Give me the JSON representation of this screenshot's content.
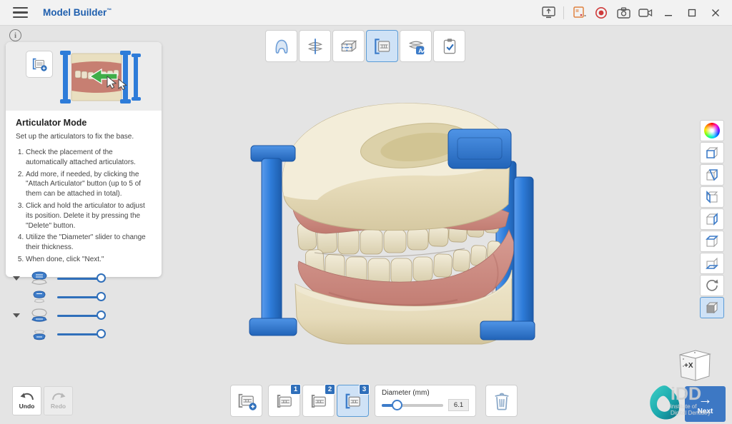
{
  "titlebar": {
    "title": "Model Builder",
    "title_mark": "™",
    "tool_icons": [
      "screen-share",
      "capture-panel",
      "record",
      "screenshot-camera",
      "video-capture"
    ],
    "window_controls": [
      "minimize",
      "maximize",
      "close"
    ]
  },
  "workflow_toolbar": {
    "steps": [
      {
        "icon": "impression-step",
        "selected": false
      },
      {
        "icon": "occlusion-step",
        "selected": false
      },
      {
        "icon": "base-step",
        "selected": false
      },
      {
        "icon": "articulator-step",
        "selected": true
      },
      {
        "icon": "label-step",
        "selected": false
      },
      {
        "icon": "finish-step",
        "selected": false
      }
    ]
  },
  "instruction_card": {
    "info_icon": "i",
    "thumb_icon": "attach-articulator",
    "title": "Articulator Mode",
    "intro": "Set up the articulators to fix the base.",
    "steps": [
      "Check the placement of the automatically attached articulators.",
      "Add more, if needed, by clicking the \"Attach Articulator\" button (up to 5 of them can be attached in total).",
      "Click and hold the articulator to adjust its position. Delete it by pressing the \"Delete\" button.",
      "Utilize the \"Diameter\" slider to change their thickness.",
      "When done, click \"Next.\""
    ]
  },
  "opacity_panel": {
    "sliders": [
      {
        "icon": "upper-jaw-visibility",
        "value_percent": 100,
        "expandable": true
      },
      {
        "icon": "upper-teeth-visibility",
        "value_percent": 100,
        "expandable": false
      },
      {
        "icon": "lower-jaw-visibility",
        "value_percent": 100,
        "expandable": true
      },
      {
        "icon": "lower-teeth-visibility",
        "value_percent": 100,
        "expandable": false
      }
    ]
  },
  "view_toolbar": {
    "buttons": [
      "color-wheel",
      "view-front",
      "view-back",
      "view-left",
      "view-right",
      "view-top",
      "view-bottom",
      "reset-rotation",
      "shaded-view"
    ],
    "selected": "shaded-view"
  },
  "view_cube": {
    "face_label": "+X"
  },
  "bottom_toolbar": {
    "attach_button_icon": "attach-articulator",
    "articulator_buttons": [
      {
        "label": "1",
        "selected": false
      },
      {
        "label": "2",
        "selected": false
      },
      {
        "label": "3",
        "selected": true
      }
    ],
    "diameter": {
      "label": "Diameter (mm)",
      "value": "6.1",
      "percent": 25
    },
    "delete_button_icon": "trash"
  },
  "history": {
    "undo_label": "Undo",
    "redo_label": "Redo",
    "redo_enabled": false
  },
  "footer": {
    "next_label": "Next",
    "next_arrow": "→"
  },
  "brand": {
    "name": "iDD",
    "line1": "institute of",
    "line2": "Digital Dentistry"
  },
  "colors": {
    "accent_blue": "#2F6FBA",
    "selected_bg": "#CFE2F6",
    "record_red": "#D63B3B",
    "capture_orange": "#E0823F",
    "articulator_blue": "#2E7CD9",
    "base_cream": "#EDE5C9",
    "gum_pink": "#CF8E85",
    "teeth_ivory": "#EDE6D0",
    "logo_teal": "#2BB5B8",
    "next_button_blue": "#3D78C4"
  }
}
